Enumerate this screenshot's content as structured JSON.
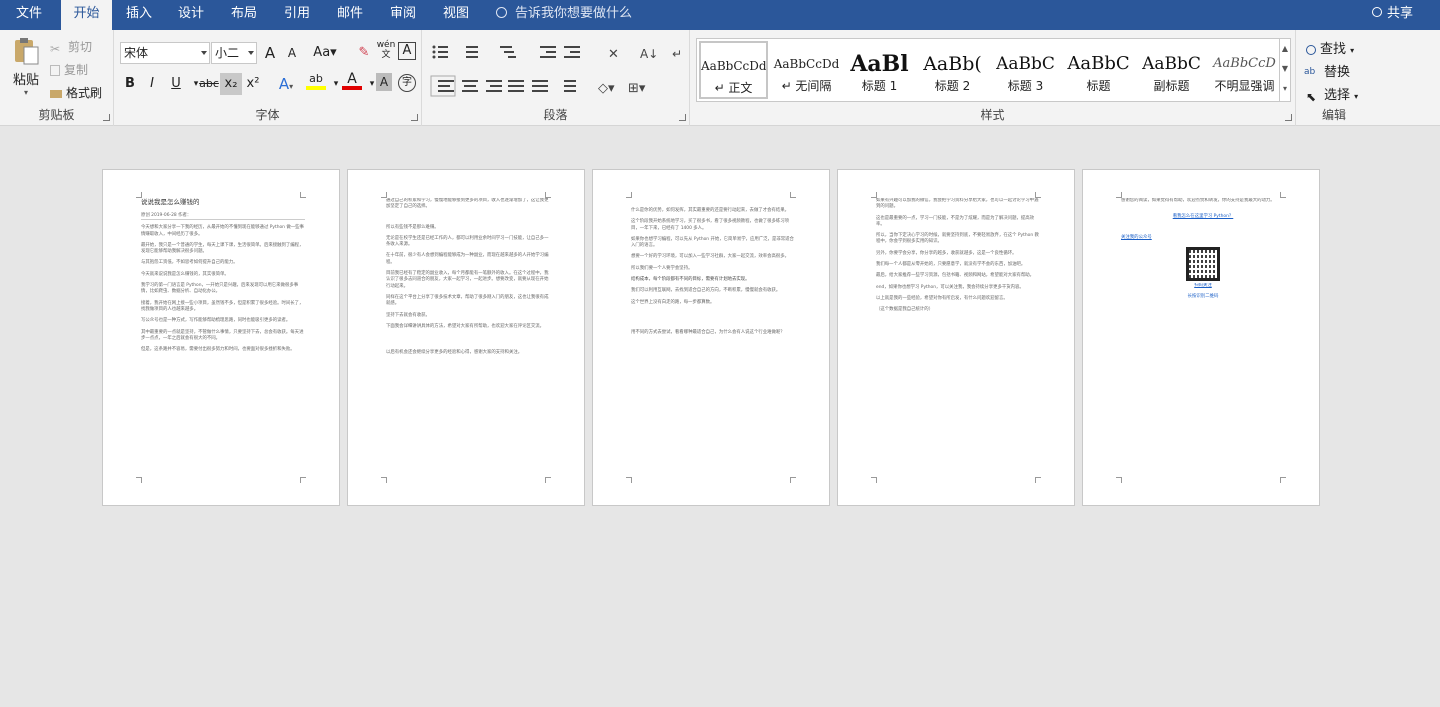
{
  "tabs": {
    "file": "文件",
    "home": "开始",
    "insert": "插入",
    "design": "设计",
    "layout": "布局",
    "references": "引用",
    "mailings": "邮件",
    "review": "审阅",
    "view": "视图"
  },
  "tellme": "告诉我你想要做什么",
  "share": "共享",
  "clipboard": {
    "paste": "粘贴",
    "cut": "剪切",
    "copy": "复制",
    "format_painter": "格式刷",
    "label": "剪贴板"
  },
  "font": {
    "name": "宋体",
    "size": "小二",
    "case": "Aa",
    "label": "字体",
    "wen": "wén",
    "wen_char": "文",
    "A": "A",
    "bold": "B",
    "italic": "I",
    "underline": "U",
    "strike": "abc",
    "sub": "x₂",
    "sup": "x²",
    "ab": "ab",
    "char_shade": "A",
    "circle": "字"
  },
  "paragraph": {
    "label": "段落"
  },
  "styles": {
    "label": "样式",
    "items": [
      {
        "preview": "AaBbCcDd",
        "name": "↵ 正文"
      },
      {
        "preview": "AaBbCcDd",
        "name": "↵ 无间隔"
      },
      {
        "preview": "AaBl",
        "name": "标题 1"
      },
      {
        "preview": "AaBb(",
        "name": "标题 2"
      },
      {
        "preview": "AaBbC",
        "name": "标题 3"
      },
      {
        "preview": "AaBbC",
        "name": "标题"
      },
      {
        "preview": "AaBbC",
        "name": "副标题"
      },
      {
        "preview": "AaBbCcD",
        "name": "不明显强调"
      }
    ]
  },
  "editing": {
    "find": "查找",
    "replace": "替换",
    "select": "选择",
    "label": "编辑"
  },
  "colors": {
    "accent": "#2b579a",
    "highlight": "#ffff00",
    "fontcolor": "#e00000"
  },
  "pages": {
    "p1": {
      "title": "说说我是怎么赚钱的",
      "meta": "原创 2019-06-28 作者：",
      "paras": [
        "今天想和大家分享一下我的经历，从最开始的不懂到现在能够通过 Python 做一些事情赚取收入，中间经历了很多。",
        "最开始，我只是一个普通的学生，每天上课下课，生活很简单。后来接触到了编程，发现它能够帮助我解决很多问题。",
        "与其抱怨工资低，不如思考如何提升自己的能力。",
        "今天就来说说我是怎么赚钱的，其实很简单。",
        "我学习的第一门语言是 Python，一开始只是兴趣，后来发现可以用它来做很多事情，比如爬虫、数据分析、自动化办公。",
        "接着，我开始在网上接一些小项目，虽然钱不多，但是积累了很多经验。时间长了，找我做项目的人也越来越多。",
        "写公众号也是一种方式，写作能够帮助梳理思路，同时也能吸引更多的读者。",
        "其中最重要的一点就是坚持，不管做什么事情，只要坚持下去，总会有收获。每天进步一点点，一年之后就会有很大的不同。",
        "但是，这条路并不容易，需要付出很多努力和时间，也要面对很多挫折和失败。"
      ]
    },
    "p2": {
      "paras": [
        "通过自己的积累和学习，慢慢地能够接到更多的项目，收入也逐渐增加了，这让我更加坚定了自己的选择。",
        "所以有些钱不是那么难赚。",
        "无论是在校学生还是已经工作的人，都可以利用业余时间学习一门技能，让自己多一条收入来源。",
        "在十年前，很少有人会想到编程能够成为一种副业，而现在越来越多的人开始学习编程。",
        "目前我已经有了稳定的副业收入，每个月都能有一笔额外的收入。在这个过程中，我认识了很多志同道合的朋友，大家一起学习，一起进步。想要改变，就要从现在开始行动起来。",
        "同样在这个平台上分享了很多技术文章，帮助了很多刚入门的朋友，这也让我很有成就感。",
        "坚持下去就会有收获。",
        "下面我会详细讲讲具体的方法，希望对大家有所帮助，也欢迎大家在评论区交流。",
        "以后有机会还会继续分享更多的经验和心得，感谢大家的支持和关注。"
      ]
    },
    "p3": {
      "paras": [
        "什么是你的优势，如何发挥，其实最重要的还是要行动起来，去做了才会有结果。",
        "这个阶段我开始系统地学习，买了很多书，看了很多视频教程，也做了很多练习项目，一年下来，已经有了 1400 多人。",
        "如果你也想学习编程，可以先从 Python 开始，它简单易学，应用广泛，是非常适合入门的语言。",
        "想要一个好的学习环境，可以加入一些学习社群，大家一起交流，效率会高很多。",
        "所以我们要一个人要学会坚持。",
        "结构成本，每个阶段都有不同的目标，需要有计划地去实现。",
        "我们可以利用互联网，去找到适合自己的方向，不断积累，慢慢就会有收获。",
        "这个世界上没有白走的路，每一步都算数。",
        "用不同的方式去尝试，看看哪种最适合自己，为什么会有人说这个行业难做呢？"
      ]
    },
    "p4": {
      "paras": [
        "如果有兴趣可以加我的微信，我会把学习资料分享给大家，也可以一起讨论学习中遇到的问题。",
        "这也是最重要的一点，学习一门技能，不是为了炫耀，而是为了解决问题，提高效率。",
        "所以，当你下定决心学习的时候，就要坚持到底，不要轻易放弃，在这个 Python 教程中，你会学到很多实用的知识。",
        "另外，你要学会分享，你分享的越多，收获就越多，这是一个良性循环。",
        "我们每一个人都是从零开始的，只要愿意学，就没有学不会的东西，加油吧。",
        "最后，给大家推荐一些学习资源，包括书籍、视频和网站，希望能对大家有帮助。",
        "end，如果你也想学习 Python，可以关注我，我会持续分享更多干货内容。",
        "以上就是我的一些经验，希望对你有所启发，有什么问题欢迎留言。",
        "（这个数据是我自己统计的）"
      ]
    },
    "p5": {
      "paras": [
        "感谢您的阅读，如果觉得有帮助，欢迎点赞和转发，你的支持是我最大的动力。"
      ],
      "link": "看我怎么在这里学习 Python？",
      "link2": "关注我的公众号",
      "link3": "扫码关注",
      "caption": "长按识别二维码"
    }
  }
}
